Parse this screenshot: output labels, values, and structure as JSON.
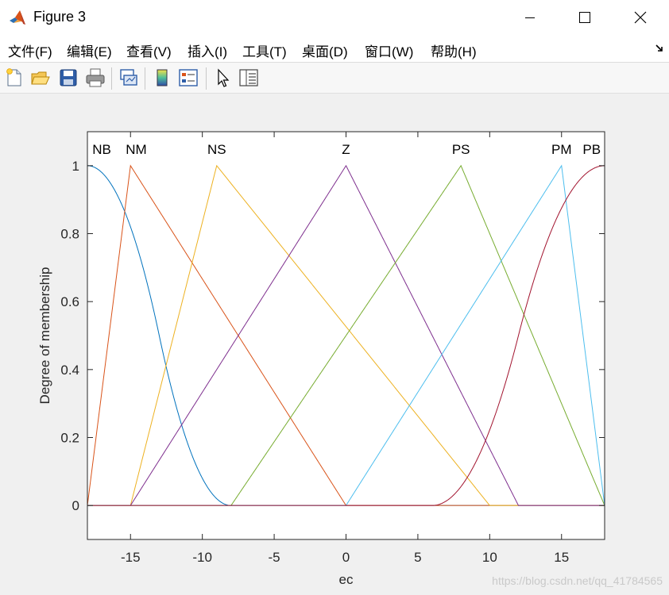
{
  "window": {
    "title": "Figure 3"
  },
  "menu": {
    "items": [
      "文件(F)",
      "编辑(E)",
      "查看(V)",
      "插入(I)",
      "工具(T)",
      "桌面(D)",
      "窗口(W)",
      "帮助(H)"
    ]
  },
  "toolbar": {
    "buttons": [
      "new-figure",
      "open-file",
      "save-figure",
      "print-figure",
      "link-plot",
      "insert-colorbar",
      "insert-legend",
      "edit-plot",
      "property-inspector"
    ]
  },
  "watermark": "https://blog.csdn.net/qq_41784565",
  "chart_data": {
    "type": "line",
    "xlabel": "ec",
    "ylabel": "Degree of membership",
    "xlim": [
      -18,
      18
    ],
    "ylim": [
      -0.1,
      1.1
    ],
    "xticks": [
      -15,
      -10,
      -5,
      0,
      5,
      10,
      15
    ],
    "yticks": [
      0,
      0.2,
      0.4,
      0.6,
      0.8,
      1
    ],
    "grid": false,
    "series": [
      {
        "name": "NB",
        "shape": "z-shaped",
        "params": [
          -18,
          -8
        ],
        "color": "#0072BD",
        "label_x": -17
      },
      {
        "name": "NM",
        "shape": "triangle",
        "params": [
          -18,
          -15,
          0
        ],
        "color": "#D95319",
        "label_x": -14.6
      },
      {
        "name": "NS",
        "shape": "triangle",
        "params": [
          -15,
          -9,
          10
        ],
        "color": "#EDB120",
        "label_x": -9
      },
      {
        "name": "Z",
        "shape": "triangle",
        "params": [
          -15,
          0,
          12
        ],
        "color": "#7E2F8E",
        "label_x": 0
      },
      {
        "name": "PS",
        "shape": "triangle",
        "params": [
          -8,
          8,
          18
        ],
        "color": "#77AC30",
        "label_x": 8
      },
      {
        "name": "PM",
        "shape": "triangle",
        "params": [
          0,
          15,
          18
        ],
        "color": "#4DBEEE",
        "label_x": 15
      },
      {
        "name": "PB",
        "shape": "s-shaped",
        "params": [
          6,
          18
        ],
        "color": "#A2142F",
        "label_x": 17.1
      }
    ]
  }
}
